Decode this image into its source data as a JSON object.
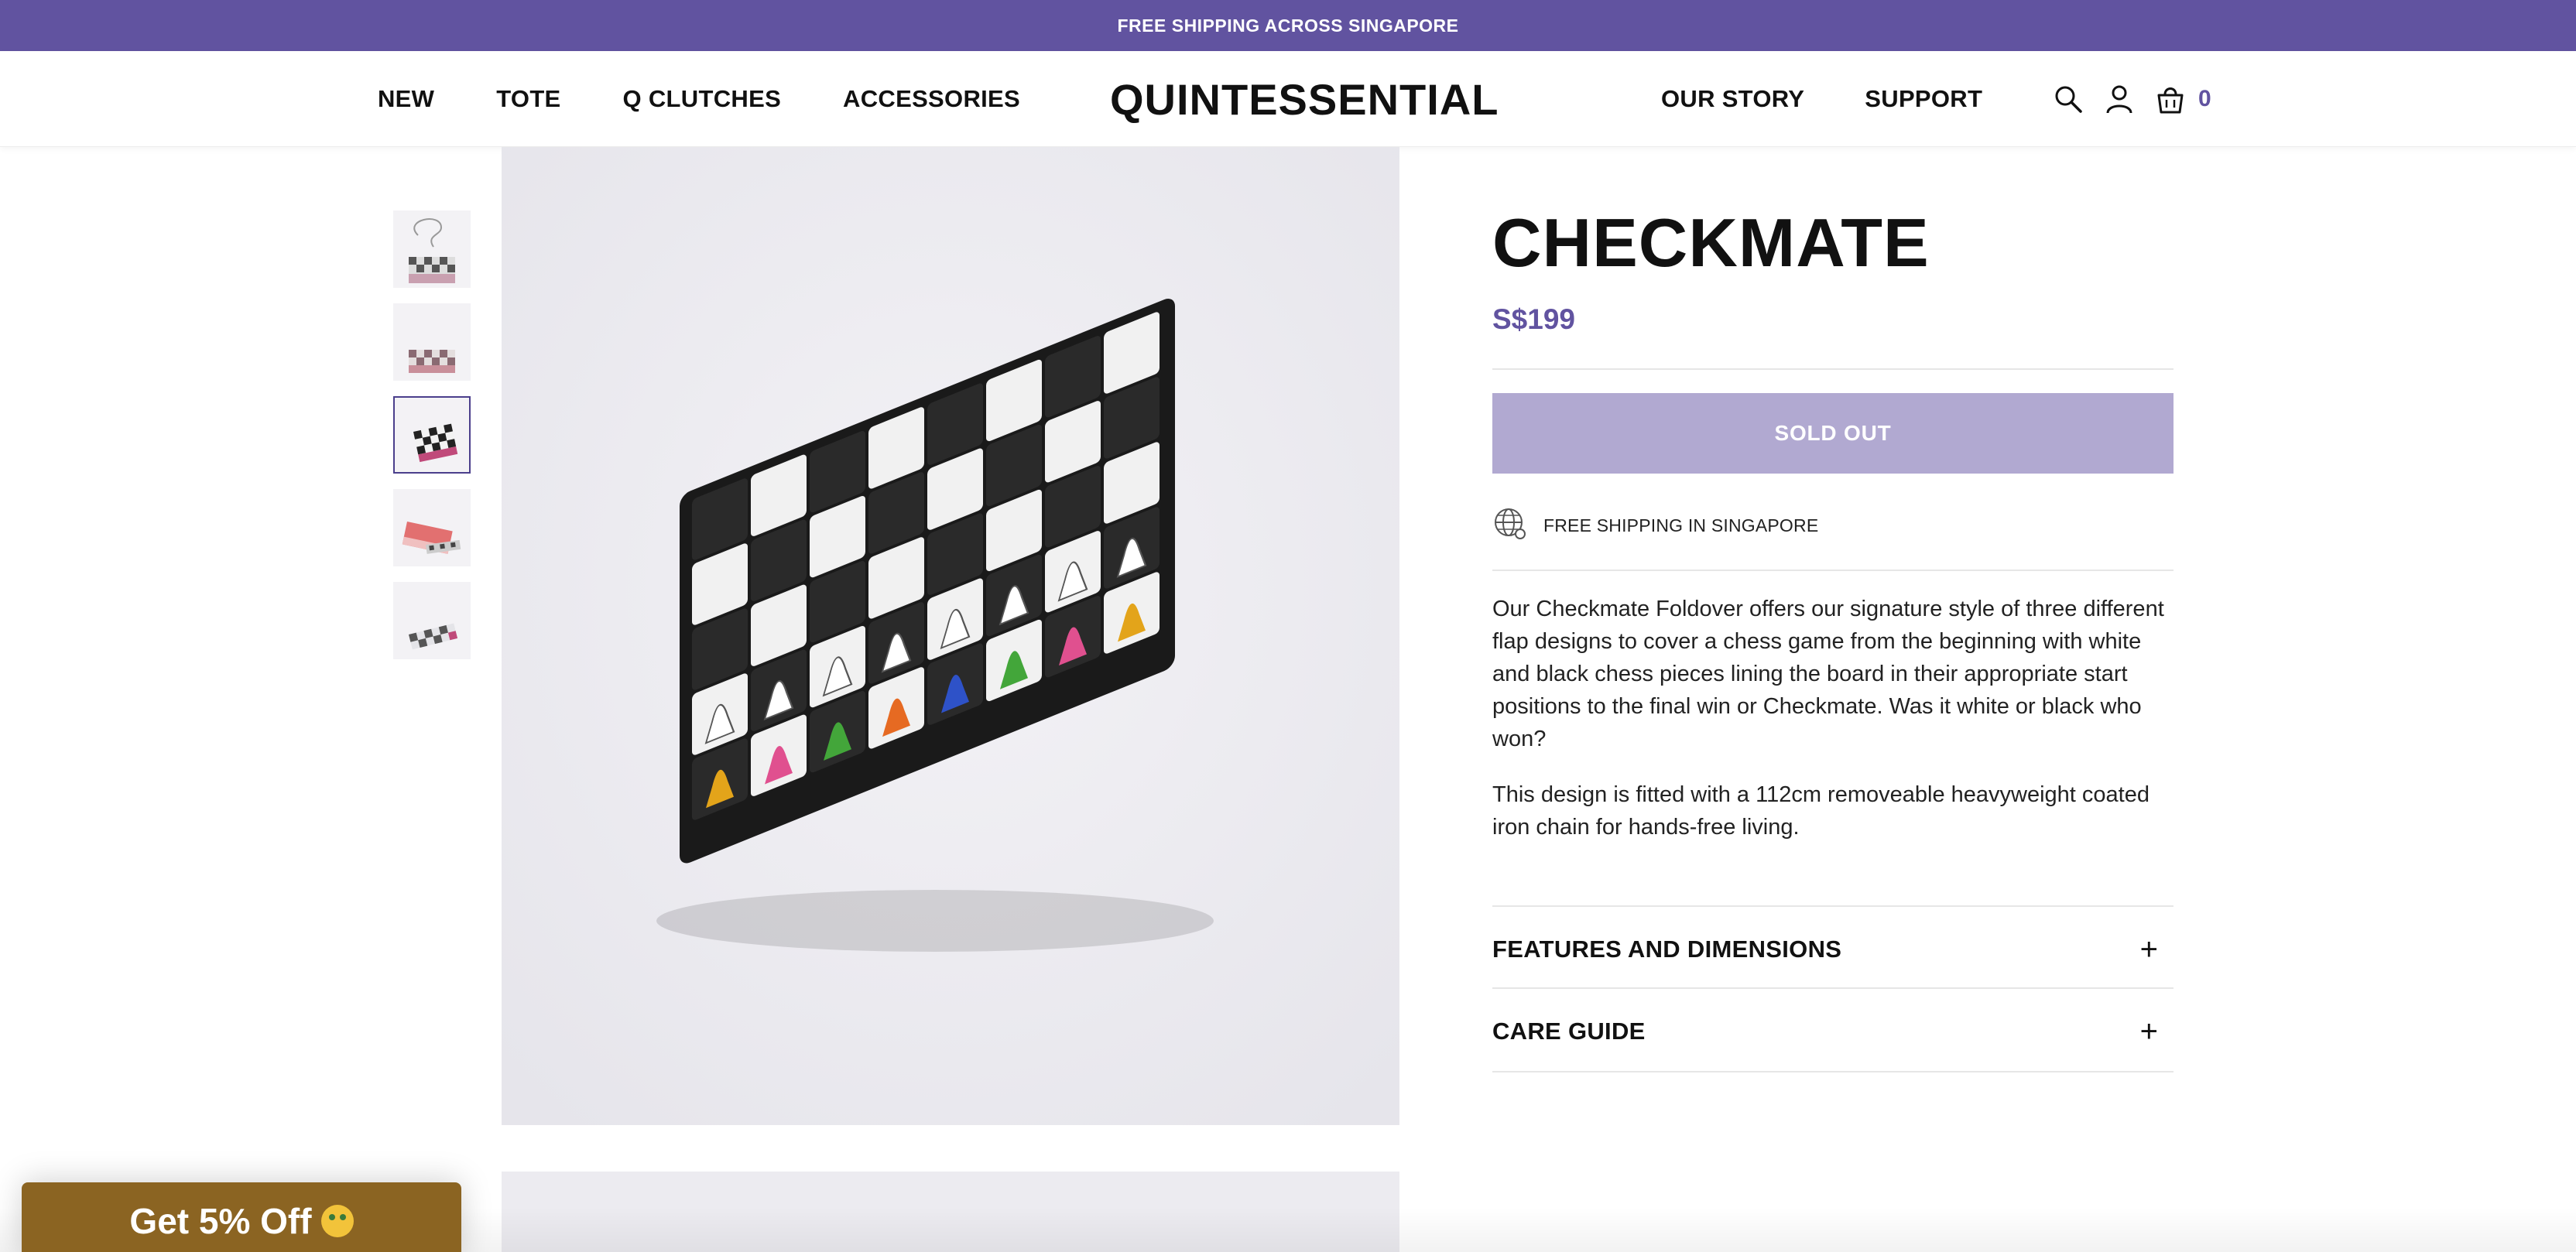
{
  "announcement": {
    "text": "FREE SHIPPING ACROSS SINGAPORE"
  },
  "header": {
    "logo": "QUINTESSENTIAL",
    "nav_left": [
      "NEW",
      "TOTE",
      "Q CLUTCHES",
      "ACCESSORIES"
    ],
    "nav_right": [
      "OUR STORY",
      "SUPPORT"
    ],
    "icons": [
      "search-icon",
      "account-icon",
      "cart-icon"
    ],
    "cart_count": "0",
    "accent_color": "#6153a0"
  },
  "gallery": {
    "thumbnails": [
      "thumbnail-1",
      "thumbnail-2",
      "thumbnail-3",
      "thumbnail-4",
      "thumbnail-5"
    ],
    "active_thumbnail_index": 2
  },
  "product": {
    "title": "CHECKMATE",
    "price": "S$199",
    "button_label": "SOLD OUT",
    "button_color": "#b1a9d1",
    "shipping_note": "FREE SHIPPING IN SINGAPORE",
    "description": [
      "Our Checkmate Foldover offers our signature style of three different flap designs to cover a chess game from the beginning with white and black chess pieces lining the board in their appropriate start positions to the final win or Checkmate. Was it white or black who won?",
      "This design is fitted with a 112cm removeable heavyweight coated iron chain for hands-free living."
    ],
    "accordions": [
      {
        "label": "FEATURES AND DIMENSIONS",
        "icon": "+"
      },
      {
        "label": "CARE GUIDE",
        "icon": "+"
      }
    ]
  },
  "discount_widget": {
    "label": "Get 5% Off",
    "color": "#8b6422"
  }
}
